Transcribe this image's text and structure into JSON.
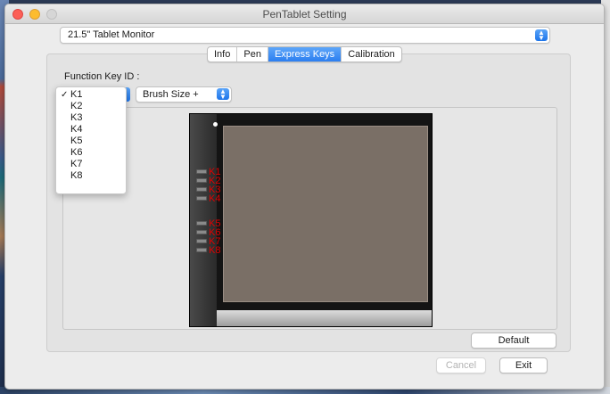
{
  "window": {
    "title": "PenTablet Setting"
  },
  "device": {
    "selected": "21.5\" Tablet Monitor"
  },
  "tabs": [
    {
      "label": "Info",
      "active": false
    },
    {
      "label": "Pen",
      "active": false
    },
    {
      "label": "Express Keys",
      "active": true
    },
    {
      "label": "Calibration",
      "active": false
    }
  ],
  "express_keys": {
    "function_key_label": "Function Key ID :",
    "selected_key": "K1",
    "key_options": [
      "K1",
      "K2",
      "K3",
      "K4",
      "K5",
      "K6",
      "K7",
      "K8"
    ],
    "function_value": "Brush Size +"
  },
  "tablet_keys": [
    "K1",
    "K2",
    "K3",
    "K4",
    "K5",
    "K6",
    "K7",
    "K8"
  ],
  "buttons": {
    "default": "Default",
    "cancel": "Cancel",
    "exit": "Exit"
  },
  "colors": {
    "accent": "#2b7ef0",
    "key_label": "#e00000"
  }
}
